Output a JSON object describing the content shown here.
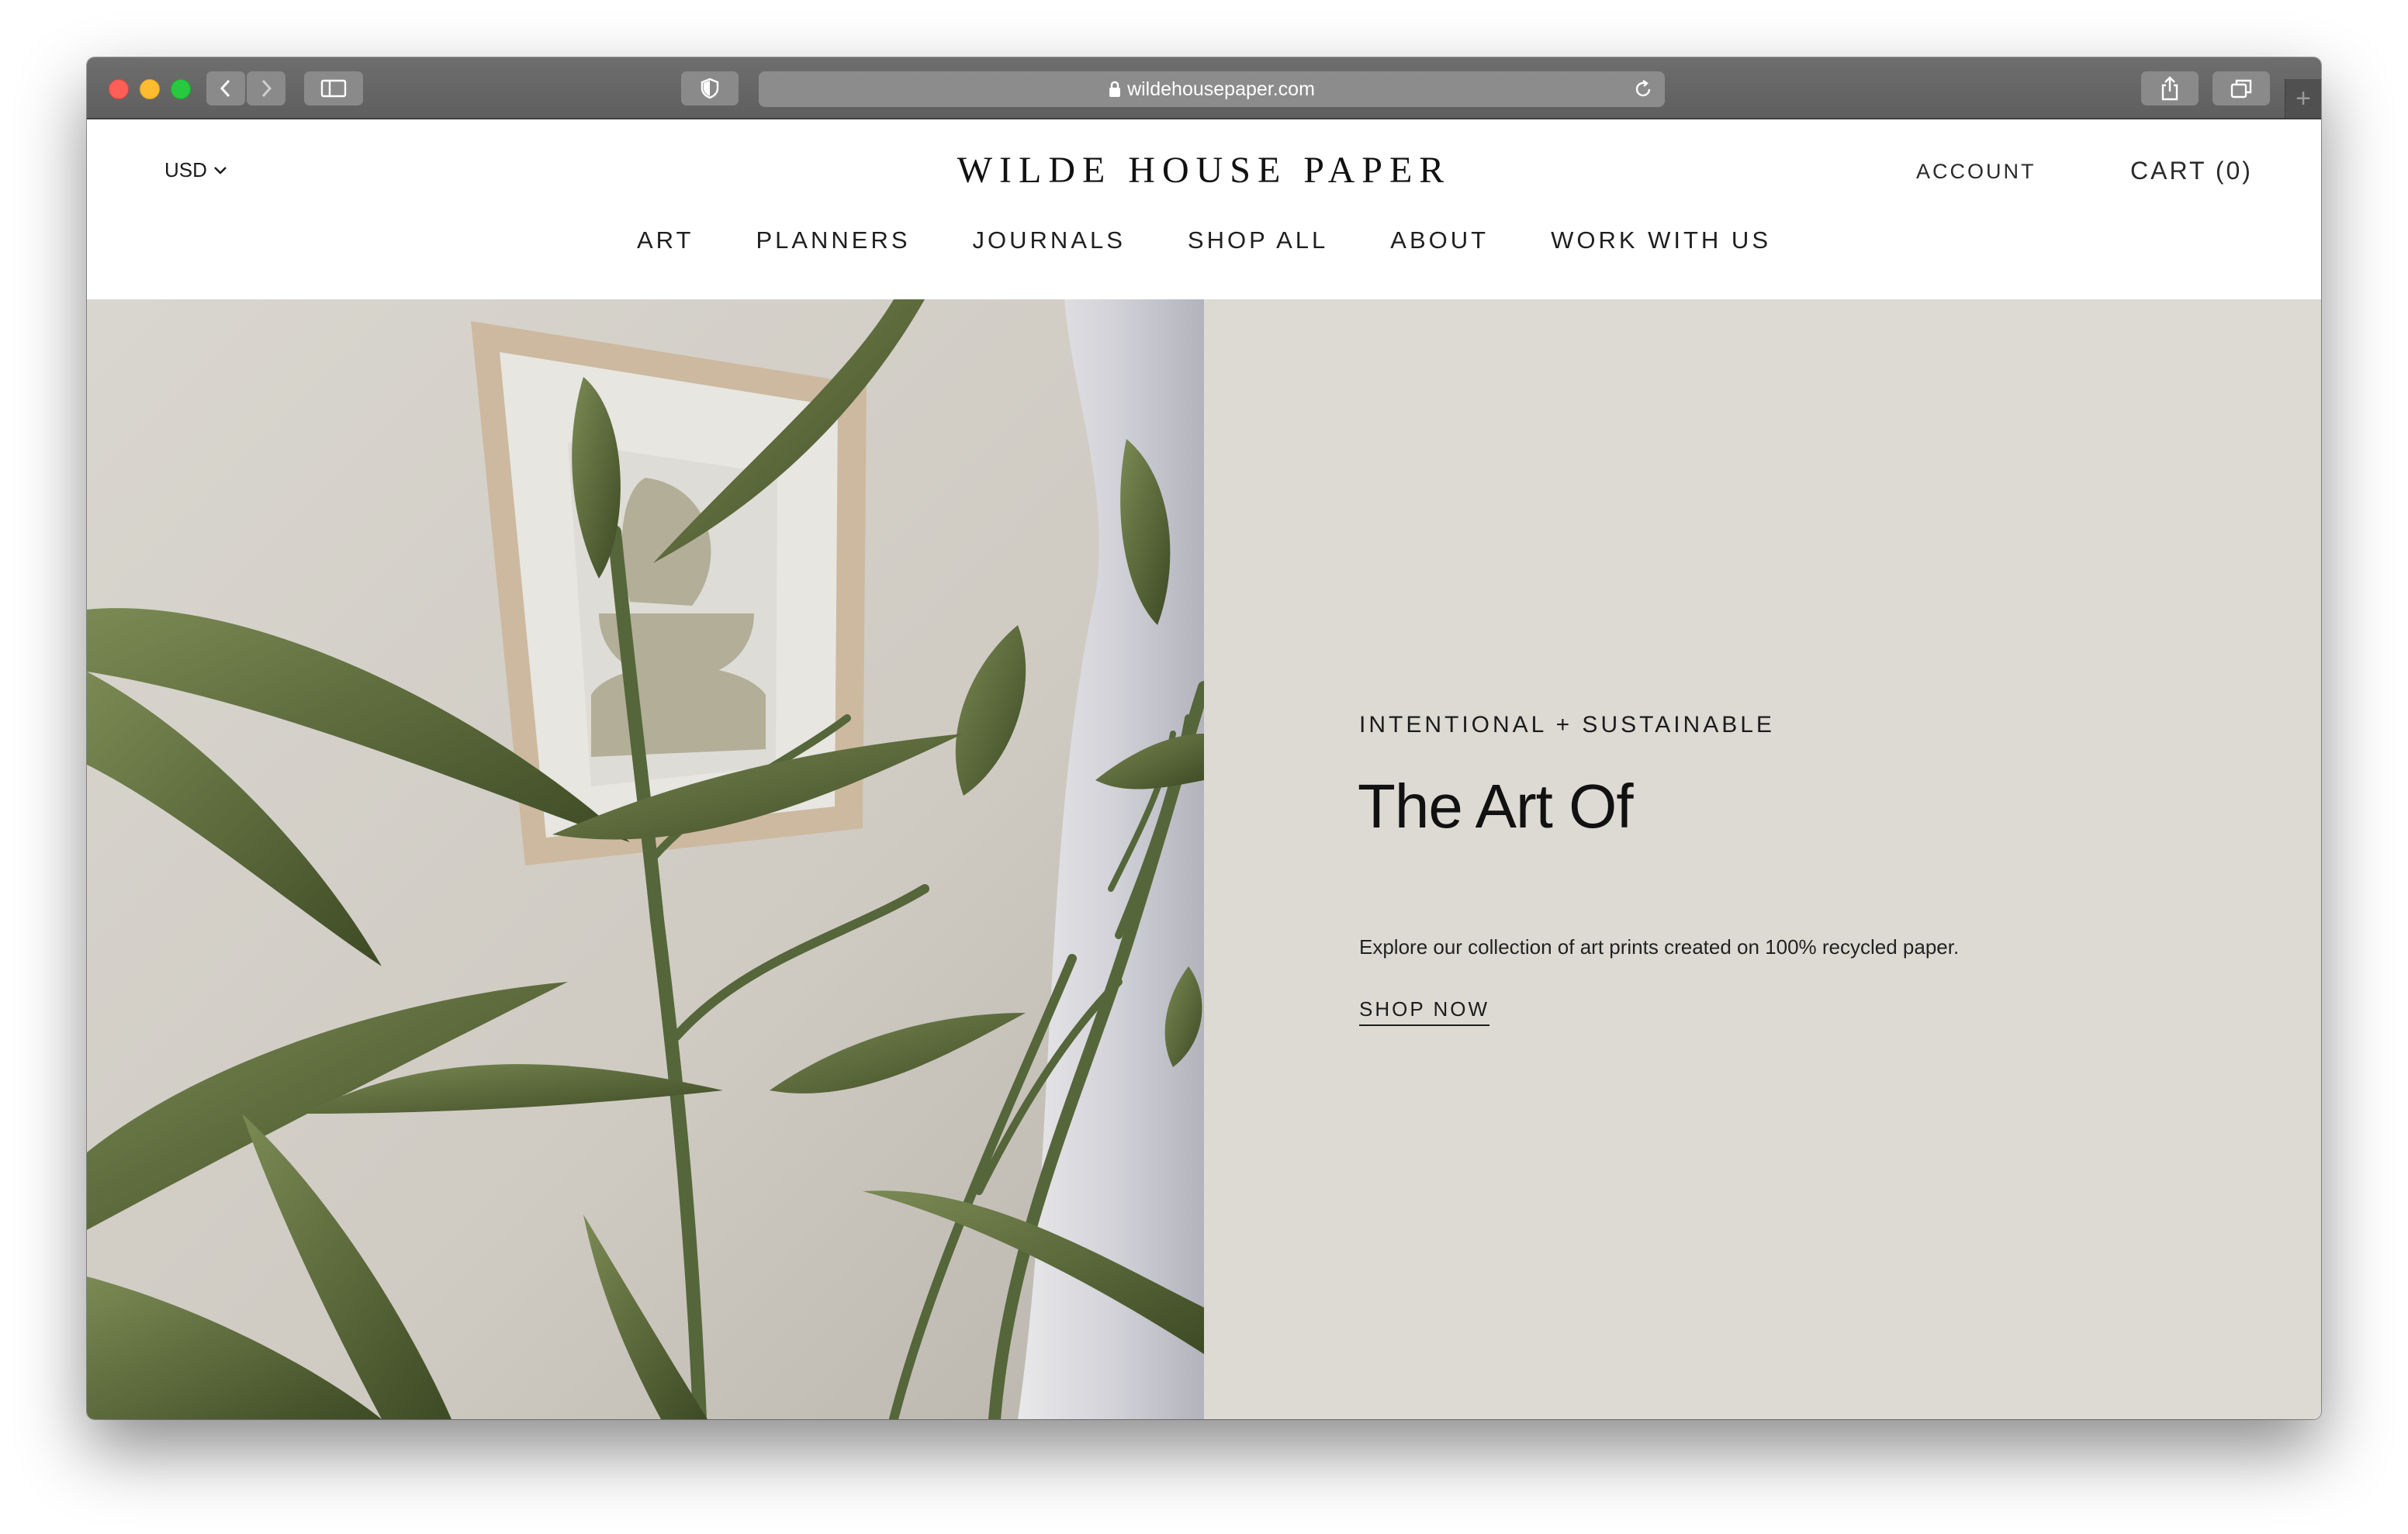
{
  "browser": {
    "url": "wildehousepaper.com"
  },
  "header": {
    "currency": "USD",
    "logo": "WILDE HOUSE PAPER",
    "account": "ACCOUNT",
    "cart": "CART (0)"
  },
  "nav": {
    "items": [
      {
        "label": "ART"
      },
      {
        "label": "PLANNERS"
      },
      {
        "label": "JOURNALS"
      },
      {
        "label": "SHOP ALL"
      },
      {
        "label": "ABOUT"
      },
      {
        "label": "WORK WITH US"
      }
    ]
  },
  "hero": {
    "eyebrow": "INTENTIONAL + SUSTAINABLE",
    "headline": "The Art Of",
    "description": "Explore our collection of art prints created on 100% recycled paper.",
    "cta": "SHOP NOW"
  },
  "colors": {
    "panel_bg": "#dcdad3",
    "chrome": "#656565",
    "leaf_green": "#4f5e33"
  }
}
